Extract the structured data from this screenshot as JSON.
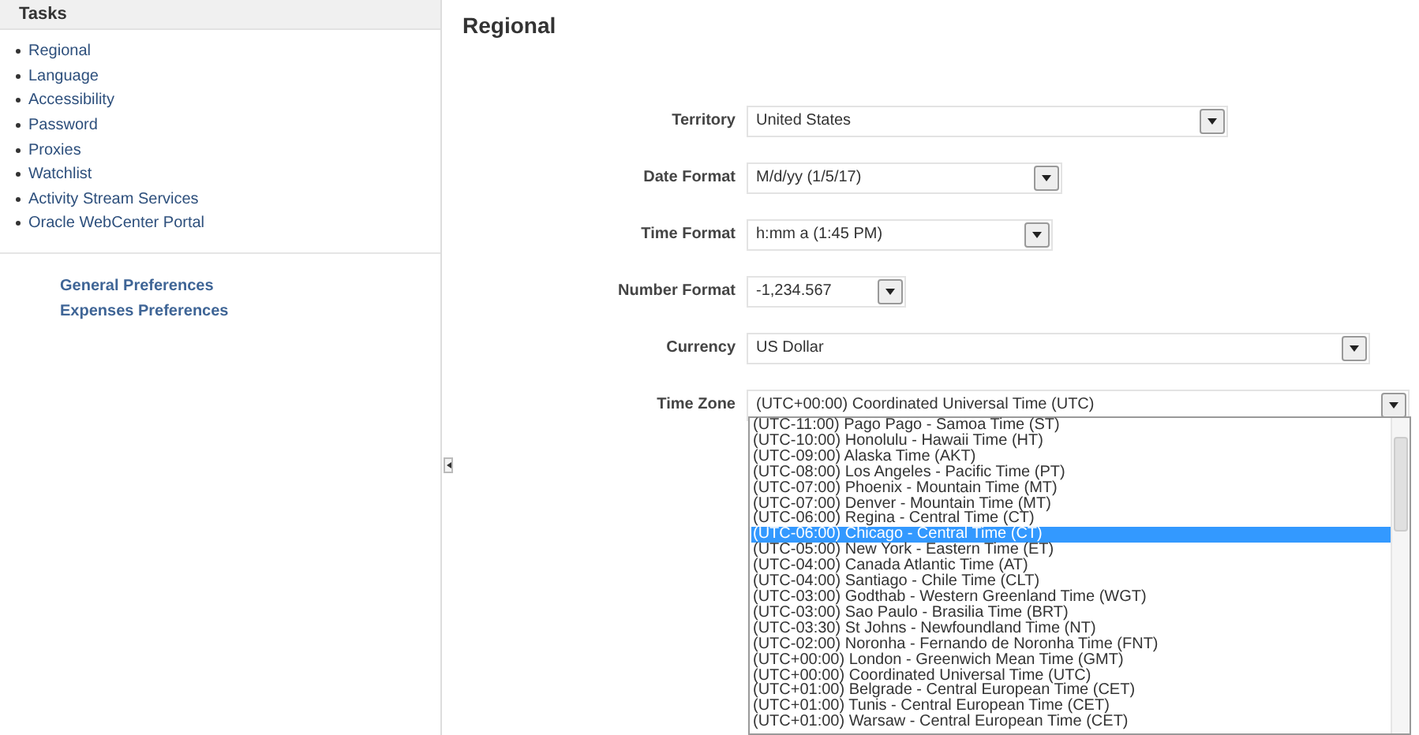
{
  "sidebar": {
    "title": "Tasks",
    "items": [
      {
        "label": "Regional"
      },
      {
        "label": "Language"
      },
      {
        "label": "Accessibility"
      },
      {
        "label": "Password"
      },
      {
        "label": "Proxies"
      },
      {
        "label": "Watchlist"
      },
      {
        "label": "Activity Stream Services"
      },
      {
        "label": "Oracle WebCenter Portal"
      }
    ],
    "links": [
      {
        "label": "General Preferences"
      },
      {
        "label": "Expenses Preferences"
      }
    ]
  },
  "page_title": "Regional",
  "fields": [
    {
      "label": "Territory",
      "value": "United States"
    },
    {
      "label": "Date Format",
      "value": "M/d/yy (1/5/17)"
    },
    {
      "label": "Time Format",
      "value": "h:mm a (1:45 PM)"
    },
    {
      "label": "Number Format",
      "value": "-1,234.567"
    },
    {
      "label": "Currency",
      "value": "US Dollar"
    },
    {
      "label": "Time Zone",
      "value": "(UTC+00:00) Coordinated Universal Time (UTC)"
    }
  ],
  "time_zone_options": [
    {
      "label": "(UTC-11:00) Pago Pago - Samoa Time (ST)",
      "selected": false
    },
    {
      "label": "(UTC-10:00) Honolulu - Hawaii Time (HT)",
      "selected": false
    },
    {
      "label": "(UTC-09:00) Alaska Time (AKT)",
      "selected": false
    },
    {
      "label": "(UTC-08:00) Los Angeles - Pacific Time (PT)",
      "selected": false
    },
    {
      "label": "(UTC-07:00) Phoenix - Mountain Time (MT)",
      "selected": false
    },
    {
      "label": "(UTC-07:00) Denver - Mountain Time (MT)",
      "selected": false
    },
    {
      "label": "(UTC-06:00) Regina - Central Time (CT)",
      "selected": false
    },
    {
      "label": "(UTC-06:00) Chicago - Central Time (CT)",
      "selected": true
    },
    {
      "label": "(UTC-05:00) New York - Eastern Time (ET)",
      "selected": false
    },
    {
      "label": "(UTC-04:00) Canada Atlantic Time (AT)",
      "selected": false
    },
    {
      "label": "(UTC-04:00) Santiago - Chile Time (CLT)",
      "selected": false
    },
    {
      "label": "(UTC-03:00) Godthab - Western Greenland Time (WGT)",
      "selected": false
    },
    {
      "label": "(UTC-03:00) Sao Paulo - Brasilia Time (BRT)",
      "selected": false
    },
    {
      "label": "(UTC-03:30) St Johns - Newfoundland Time (NT)",
      "selected": false
    },
    {
      "label": "(UTC-02:00) Noronha - Fernando de Noronha Time (FNT)",
      "selected": false
    },
    {
      "label": "(UTC+00:00) London - Greenwich Mean Time (GMT)",
      "selected": false
    },
    {
      "label": "(UTC+00:00) Coordinated Universal Time (UTC)",
      "selected": false
    },
    {
      "label": "(UTC+01:00) Belgrade - Central European Time (CET)",
      "selected": false
    },
    {
      "label": "(UTC+01:00) Tunis - Central European Time (CET)",
      "selected": false
    },
    {
      "label": "(UTC+01:00) Warsaw - Central European Time (CET)",
      "selected": false
    }
  ]
}
